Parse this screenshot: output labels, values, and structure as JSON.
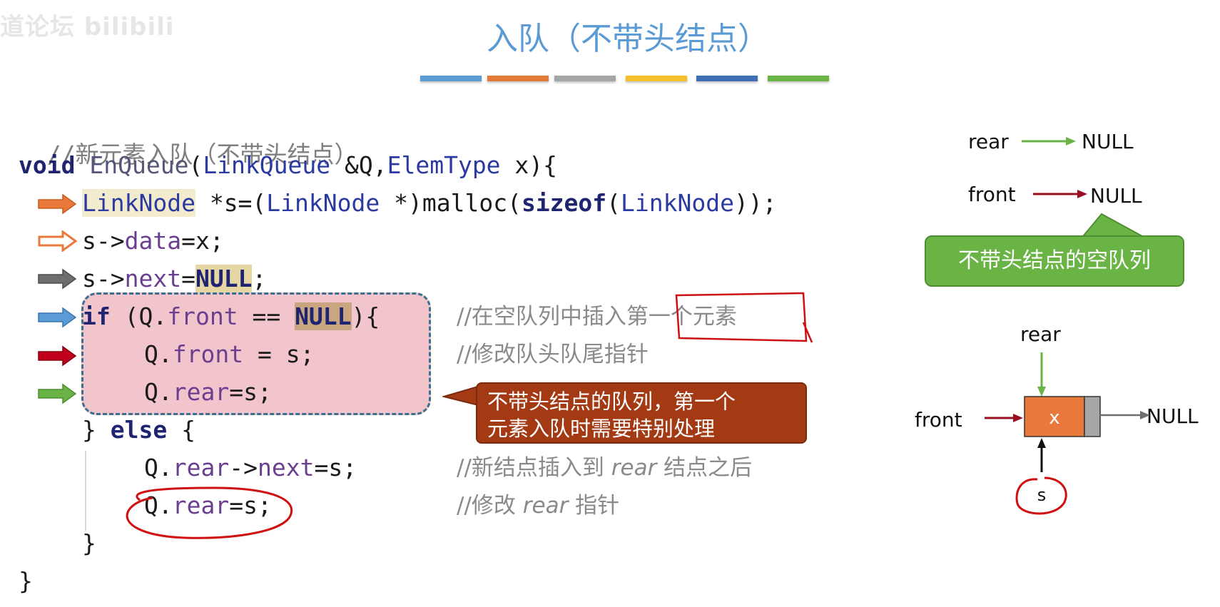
{
  "watermark": "道论坛 bilibili",
  "title": "入队（不带头结点）",
  "colors": {
    "title": "#5a9bd5",
    "title_bars": [
      "#5a9bd5",
      "#e37a3a",
      "#a6a6a6",
      "#f5c02a",
      "#3f6eb5",
      "#6ab446"
    ],
    "arrow_orange": "#e8793a",
    "arrow_gray": "#6e6e6e",
    "arrow_blue": "#5b9bd5",
    "arrow_red": "#c0001a",
    "arrow_green": "#6ab446",
    "callout_red": "#a33a14",
    "callout_green": "#6ab446",
    "node_fill": "#e8793a"
  },
  "code": {
    "comment_header": "//新元素入队（不带头结点）",
    "void": "void",
    "fname": "EnQueue",
    "lq": "LinkQueue",
    "params_mid": " &Q,",
    "et": "ElemType",
    "params_end": " x){",
    "ln1": "LinkNode",
    "l1_a": " *s=(",
    "ln2": "LinkNode",
    "l1_b": " *)malloc(",
    "sizeof": "sizeof",
    "l1_c": "(",
    "ln3": "LinkNode",
    "l1_d": "));",
    "s_arrow": "s->",
    "data": "data",
    "eq_x": "=x;",
    "s_arrow2": "s->",
    "next": "next",
    "eq": "=",
    "null1": "NULL",
    "semi": ";",
    "if_kw": "if",
    "if_a": " (Q.",
    "front": "front",
    "if_b": " == ",
    "null2": "NULL",
    "if_c": "){",
    "qf_a": "Q.",
    "front2": "front",
    "qf_b": " = s;",
    "qr_a": "Q.",
    "rear1": "rear",
    "qr_b": "=s;",
    "else_a": "} ",
    "else_kw": "else",
    "else_b": " {",
    "qrn_a": "Q.",
    "rear2": "rear",
    "qrn_b": "->",
    "next2": "next",
    "qrn_c": "=s;",
    "qr2_a": "Q.",
    "rear3": "rear",
    "qr2_b": "=s;",
    "close_inner": "}",
    "close_outer": "}"
  },
  "comments": {
    "c1_a": "//在空队列中插入",
    "c1_b": "第一个元素",
    "c2": "//修改队头队尾指针",
    "c3_a": "//新结点插入到 ",
    "c3_b": "rear",
    "c3_c": " 结点之后",
    "c4_a": "//修改 ",
    "c4_b": "rear",
    "c4_c": " 指针"
  },
  "callouts": {
    "red_line1": "不带头结点的队列，第一个",
    "red_line2": "元素入队时需要特别处理",
    "green": "不带头结点的空队列"
  },
  "diagram_top": {
    "rear": "rear",
    "front": "front",
    "null_rear": "NULL",
    "null_front": "NULL"
  },
  "diagram_bottom": {
    "rear": "rear",
    "front": "front",
    "node": "x",
    "null": "NULL",
    "s": "s"
  }
}
